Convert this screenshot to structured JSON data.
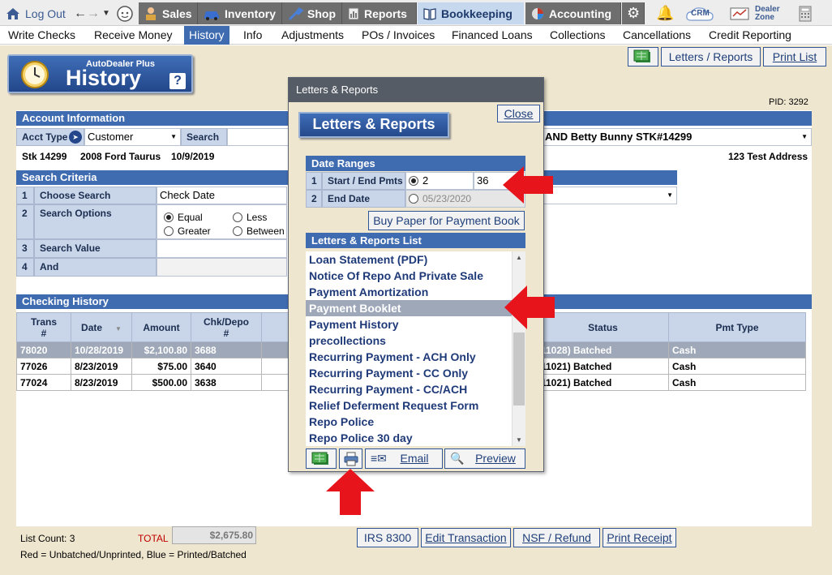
{
  "topnav": {
    "logout": "Log Out",
    "sales": "Sales",
    "inventory": "Inventory",
    "shop": "Shop",
    "reports": "Reports",
    "bookkeeping": "Bookkeeping",
    "accounting": "Accounting",
    "crm": "CRM",
    "dealer_zone_1": "Dealer",
    "dealer_zone_2": "Zone"
  },
  "menu": [
    "Write Checks",
    "Receive Money",
    "History",
    "Info",
    "Adjustments",
    "POs / Invoices",
    "Financed Loans",
    "Collections",
    "Cancellations",
    "Credit Reporting"
  ],
  "header": {
    "subtitle": "AutoDealer Plus",
    "title": "History",
    "help": "?",
    "letters_reports_btn": "Letters / Reports",
    "print_list_btn": "Print List",
    "pid": "PID: 3292"
  },
  "account": {
    "header": "Account Information",
    "acct_type_label": "Acct Type",
    "acct_type_value": "Customer",
    "search_label": "Search",
    "search_value": "AND Betty Bunny STK#14299",
    "stk": "Stk 14299",
    "vehicle": "2008 Ford Taurus",
    "date": "10/9/2019",
    "address": "123 Test Address"
  },
  "search": {
    "header": "Search Criteria",
    "rows": [
      {
        "num": "1",
        "label": "Choose Search",
        "value": "Check Date"
      },
      {
        "num": "2",
        "label": "Search Options"
      },
      {
        "num": "3",
        "label": "Search Value"
      },
      {
        "num": "4",
        "label": "And"
      }
    ],
    "options": [
      "Equal",
      "Less",
      "Greater",
      "Between"
    ]
  },
  "checking": {
    "header": "Checking History",
    "columns": [
      "Trans #",
      "Date",
      "Amount",
      "Chk/Depo #",
      "Status",
      "Pmt Type"
    ],
    "col_trans_1": "Trans",
    "col_trans_2": "#",
    "col_chk_1": "Chk/Depo",
    "col_chk_2": "#",
    "rows": [
      {
        "trans": "78020",
        "date": "10/28/2019",
        "amount": "$2,100.80",
        "chk": "3688",
        "status": "11028) Batched",
        "pmt": "Cash"
      },
      {
        "trans": "77026",
        "date": "8/23/2019",
        "amount": "$75.00",
        "chk": "3640",
        "status": "11021) Batched",
        "pmt": "Cash"
      },
      {
        "trans": "77024",
        "date": "8/23/2019",
        "amount": "$500.00",
        "chk": "3638",
        "status": "11021) Batched",
        "pmt": "Cash"
      }
    ]
  },
  "footer": {
    "list_count": "List Count: 3",
    "total_label": "TOTAL",
    "total_value": "$2,675.80",
    "legend": "Red = Unbatched/Unprinted, Blue = Printed/Batched",
    "buttons": [
      "IRS 8300",
      "Edit Transaction",
      "NSF / Refund",
      "Print Receipt"
    ]
  },
  "dialog": {
    "window_title": "Letters & Reports",
    "title": "Letters & Reports",
    "close": "Close",
    "date_ranges": "Date Ranges",
    "row1_num": "1",
    "row1_label": "Start / End Pmts",
    "start_pmt": "2",
    "end_pmt": "36",
    "row2_num": "2",
    "row2_label": "End Date",
    "end_date": "05/23/2020",
    "buy_paper": "Buy Paper for Payment Book",
    "list_header": "Letters & Reports List",
    "list": [
      "Loan Statement (PDF)",
      "Notice Of Repo And Private Sale",
      "Payment Amortization",
      "Payment Booklet",
      "Payment History",
      "precollections",
      "Recurring Payment - ACH Only",
      "Recurring Payment - CC Only",
      "Recurring Payment - CC/ACH",
      "Relief Deferment Request Form",
      "Repo Police",
      "Repo Police 30 day"
    ],
    "selected_index": 3,
    "email": "Email",
    "preview": "Preview"
  }
}
